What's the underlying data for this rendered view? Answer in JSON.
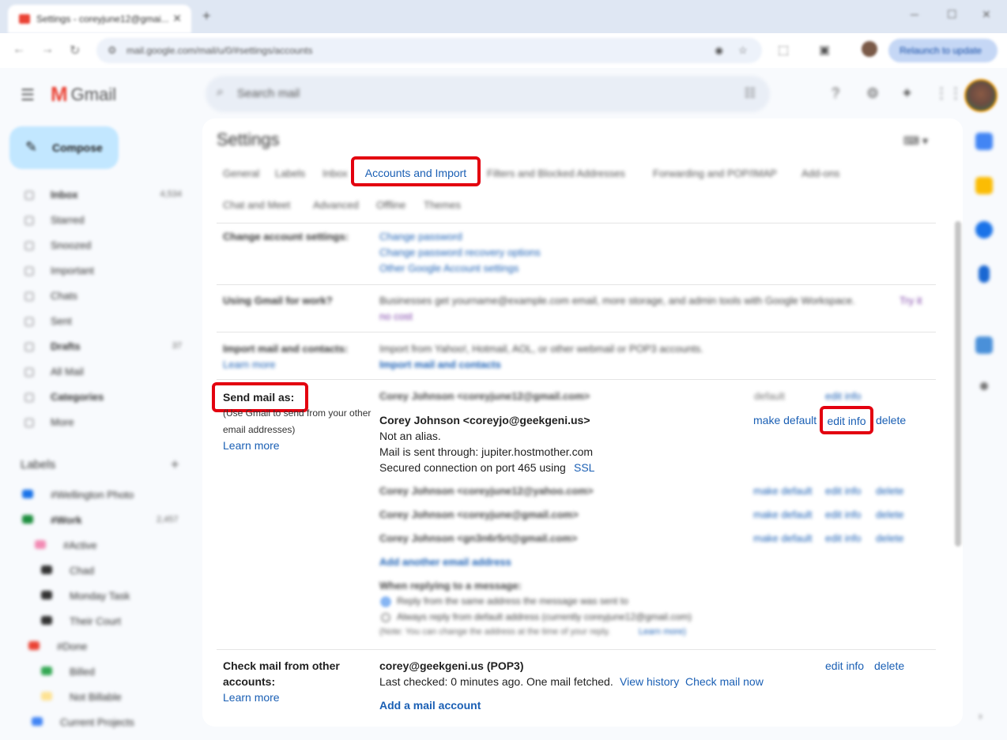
{
  "browser": {
    "tab_title": "Settings - coreyjune12@gmai...",
    "tab_close": "✕",
    "new_tab": "+",
    "url": "mail.google.com/mail/u/0/#settings/accounts",
    "relaunch_label": "Relaunch to update"
  },
  "gmail": {
    "logo_text": "Gmail",
    "search_placeholder": "Search mail",
    "compose_label": "Compose"
  },
  "nav": [
    {
      "label": "Inbox",
      "count": "4,534",
      "bold": true,
      "icon": "inbox-icon"
    },
    {
      "label": "Starred",
      "count": "",
      "icon": "star-icon"
    },
    {
      "label": "Snoozed",
      "count": "",
      "icon": "clock-icon"
    },
    {
      "label": "Important",
      "count": "",
      "icon": "important-icon"
    },
    {
      "label": "Chats",
      "count": "",
      "icon": "chat-icon"
    },
    {
      "label": "Sent",
      "count": "",
      "icon": "send-icon"
    },
    {
      "label": "Drafts",
      "count": "37",
      "bold": true,
      "icon": "draft-icon"
    },
    {
      "label": "All Mail",
      "count": "",
      "icon": "all-mail-icon"
    },
    {
      "label": "Categories",
      "count": "",
      "bold": true,
      "icon": "label-icon"
    },
    {
      "label": "More",
      "count": "",
      "icon": "chevron-down-icon"
    }
  ],
  "labels_header": "Labels",
  "labels": [
    {
      "name": "#Wellington Photo",
      "count": "",
      "color": "#1a73e8"
    },
    {
      "name": "#Work",
      "count": "2,457",
      "color": "#1e8e3e",
      "bold": true
    },
    {
      "name": "#Active",
      "count": "",
      "color": "#f28bb4"
    },
    {
      "name": "Chad",
      "count": "",
      "color": "#333333"
    },
    {
      "name": "Monday Task",
      "count": "",
      "color": "#333333"
    },
    {
      "name": "Their Court",
      "count": "",
      "color": "#333333"
    },
    {
      "name": "#Done",
      "count": "",
      "color": "#ea4335"
    },
    {
      "name": "Billed",
      "count": "",
      "color": "#34a853"
    },
    {
      "name": "Not Billable",
      "count": "",
      "color": "#fde293"
    },
    {
      "name": "Current Projects",
      "count": "",
      "color": "#4285f4"
    }
  ],
  "settings": {
    "title": "Settings",
    "tabs_row1": [
      "General",
      "Labels",
      "Inbox"
    ],
    "active_tab": "Accounts and Import",
    "tabs_row1b": [
      "Filters and Blocked Addresses",
      "Forwarding and POP/IMAP",
      "Add-ons"
    ],
    "tabs_row2": [
      "Chat and Meet",
      "Advanced",
      "Offline",
      "Themes"
    ],
    "change_account": {
      "label": "Change account settings:",
      "links": [
        "Change password",
        "Change password recovery options",
        "Other Google Account settings"
      ]
    },
    "work": {
      "label": "Using Gmail for work?",
      "text": "Businesses get yourname@example.com email, more storage, and admin tools with Google Workspace.",
      "link1": "Try it",
      "link2": "no cost"
    },
    "import": {
      "label": "Import mail and contacts:",
      "learn": "Learn more",
      "text": "Import from Yahoo!, Hotmail, AOL, or other webmail or POP3 accounts.",
      "link": "Import mail and contacts"
    },
    "send_as": {
      "label": "Send mail as:",
      "sub1": "(Use Gmail to send from your other",
      "sub2": "email addresses)",
      "learn": "Learn more",
      "row0": {
        "addr": "Corey Johnson <coreyjune12@gmail.com>",
        "status": "default",
        "edit": "edit info"
      },
      "main": {
        "addr": "Corey Johnson <coreyjo@geekgeni.us>",
        "line1": "Not an alias.",
        "line2": "Mail is sent through: jupiter.hostmother.com",
        "line3": "Secured connection on port 465 using",
        "ssl": "SSL",
        "make_default": "make default",
        "edit": "edit info",
        "delete": "delete"
      },
      "others": [
        {
          "addr": "Corey Johnson <coreyjune12@yahoo.com>",
          "make_default": "make default",
          "edit": "edit info",
          "delete": "delete"
        },
        {
          "addr": "Corey Johnson <coreyjune@gmail.com>",
          "make_default": "make default",
          "edit": "edit info",
          "delete": "delete"
        },
        {
          "addr": "Corey Johnson <gn3n6r5rt@gmail.com>",
          "make_default": "make default",
          "edit": "edit info",
          "delete": "delete"
        }
      ],
      "add_another": "Add another email address",
      "reply_header": "When replying to a message:",
      "reply_opt1": "Reply from the same address the message was sent to",
      "reply_opt2": "Always reply from default address (currently coreyjune12@gmail.com)",
      "note": "(Note: You can change the address at the time of your reply.",
      "note_link": "Learn more)"
    },
    "check_mail": {
      "label1": "Check mail from other",
      "label2": "accounts:",
      "learn": "Learn more",
      "account": "corey@geekgeni.us (POP3)",
      "last_checked": "Last checked: 0 minutes ago. One mail fetched.",
      "view_history": "View history",
      "check_now": "Check mail now",
      "edit": "edit info",
      "delete": "delete",
      "add": "Add a mail account"
    }
  },
  "colors": {
    "highlight": "#e3000f",
    "link": "#1a5fb4",
    "compose_bg": "#c2e7ff"
  }
}
